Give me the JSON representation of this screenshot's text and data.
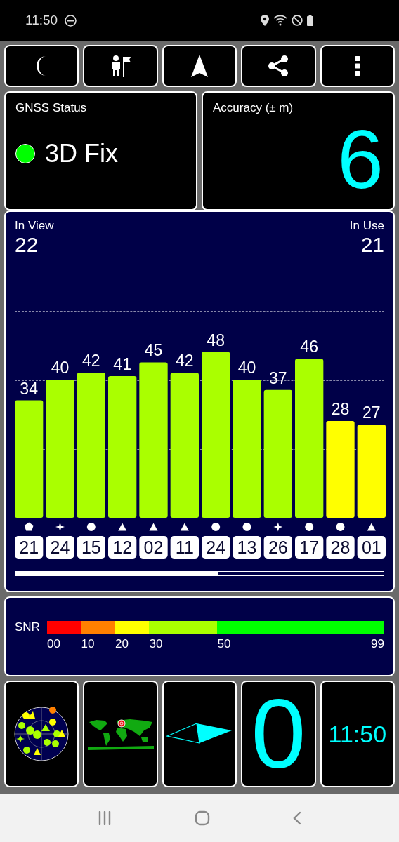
{
  "status_bar": {
    "time": "11:50"
  },
  "toolbar": [
    {
      "kind": "night"
    },
    {
      "kind": "person_flag"
    },
    {
      "kind": "navigate"
    },
    {
      "kind": "share"
    },
    {
      "kind": "more"
    }
  ],
  "gnss_status": {
    "title": "GNSS Status",
    "fix": "3D Fix",
    "color": "#00ff00"
  },
  "accuracy": {
    "title": "Accuracy (± m)",
    "value": "6"
  },
  "satellites": {
    "in_view_label": "In View",
    "in_view": "22",
    "in_use_label": "In Use",
    "in_use": "21",
    "chart_data": {
      "type": "bar",
      "categories": [
        "21",
        "24",
        "15",
        "12",
        "02",
        "11",
        "24",
        "13",
        "26",
        "17",
        "28",
        "01"
      ],
      "values": [
        34,
        40,
        42,
        41,
        45,
        42,
        48,
        40,
        37,
        46,
        28,
        27
      ],
      "data_labels": true
    },
    "markers": [
      {
        "kind": "pentagon"
      },
      {
        "kind": "star"
      },
      {
        "kind": "circle"
      },
      {
        "kind": "triangle"
      },
      {
        "kind": "triangle"
      },
      {
        "kind": "triangle"
      },
      {
        "kind": "circle"
      },
      {
        "kind": "circle"
      },
      {
        "kind": "star"
      },
      {
        "kind": "circle"
      },
      {
        "kind": "circle"
      },
      {
        "kind": "triangle"
      }
    ]
  },
  "snr_scale": {
    "label": "SNR",
    "ticks": [
      "00",
      "10",
      "20",
      "30",
      "50",
      "99"
    ],
    "segments": [
      {
        "color": "#ff0000"
      },
      {
        "color": "#ff8000"
      },
      {
        "color": "#ffff00"
      },
      {
        "color": "#aaff00"
      },
      {
        "color": "#00ff00"
      }
    ]
  },
  "tiles": [
    {
      "kind": "sky_plot"
    },
    {
      "kind": "world_map"
    },
    {
      "kind": "compass"
    },
    {
      "kind": "speed",
      "value": "0"
    },
    {
      "kind": "clock",
      "value": "11:50"
    }
  ]
}
